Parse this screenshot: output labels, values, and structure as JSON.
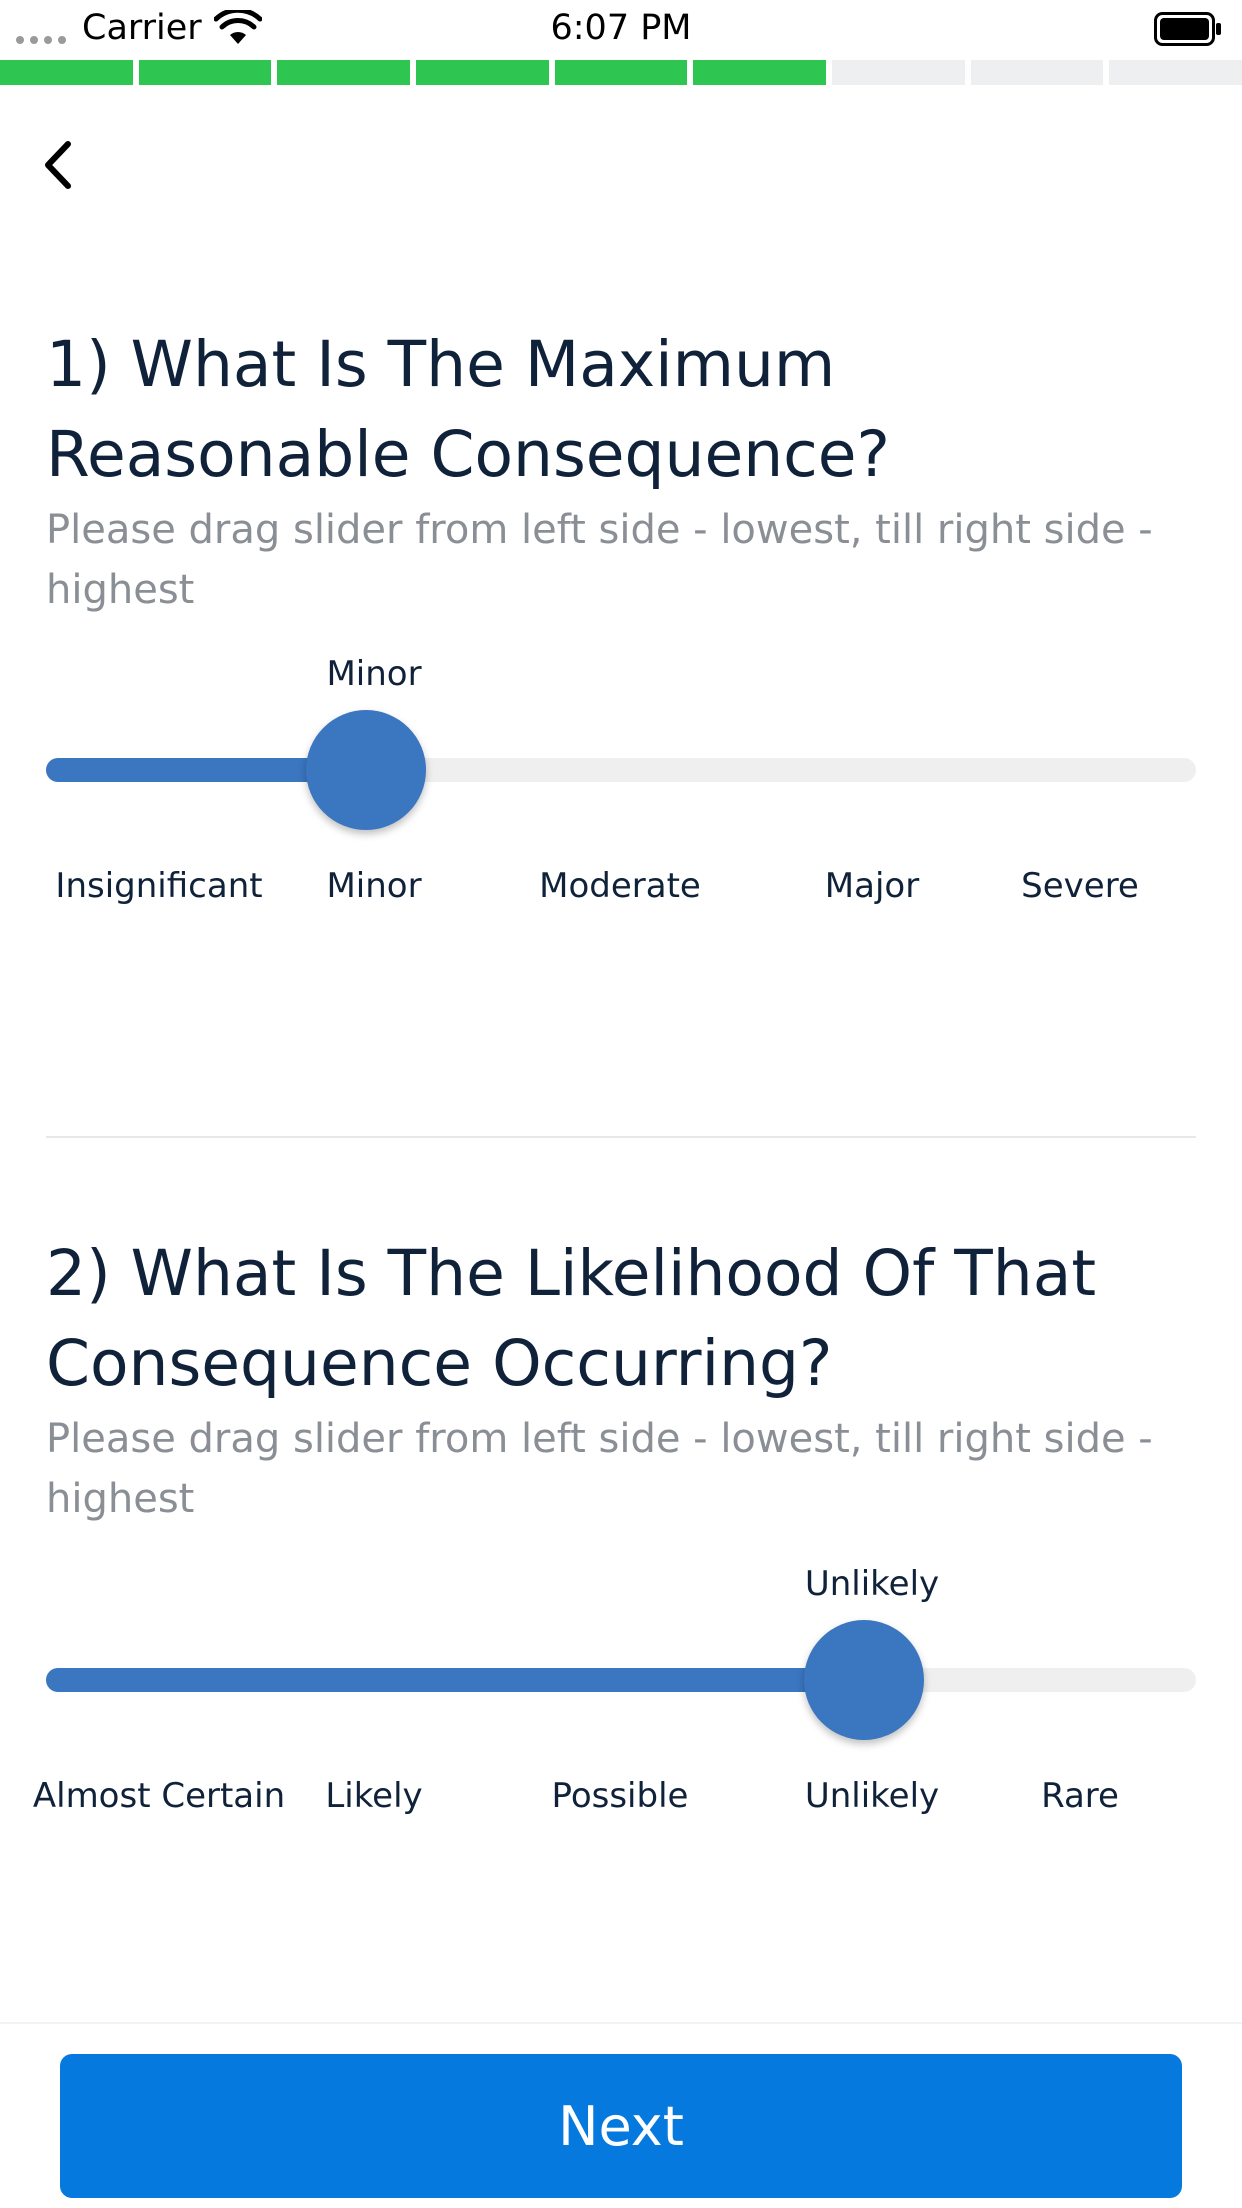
{
  "status_bar": {
    "carrier": "Carrier",
    "time": "6:07 PM"
  },
  "progress": {
    "total_steps": 9,
    "completed_steps": 6,
    "done_color": "#2fc551",
    "pending_color": "#eeeff0"
  },
  "back_icon": "chevron-left-icon",
  "question1": {
    "title": "1) What Is The Maximum Reasonable Consequence?",
    "hint": "Please drag slider from left side - lowest, till right side - highest",
    "selected_label": "Minor",
    "value_index": 1,
    "options": [
      "Insignificant",
      "Minor",
      "Moderate",
      "Major",
      "Severe"
    ]
  },
  "question2": {
    "title": "2) What Is The Likelihood Of That Consequence Occurring?",
    "hint": "Please drag slider from left side - lowest, till right side - highest",
    "selected_label": "Unlikely",
    "value_index": 3,
    "options": [
      "Almost Certain",
      "Likely",
      "Possible",
      "Unlikely",
      "Rare"
    ]
  },
  "next_button": {
    "label": "Next",
    "color": "#0679de"
  },
  "accent_color": "#3b76c0"
}
